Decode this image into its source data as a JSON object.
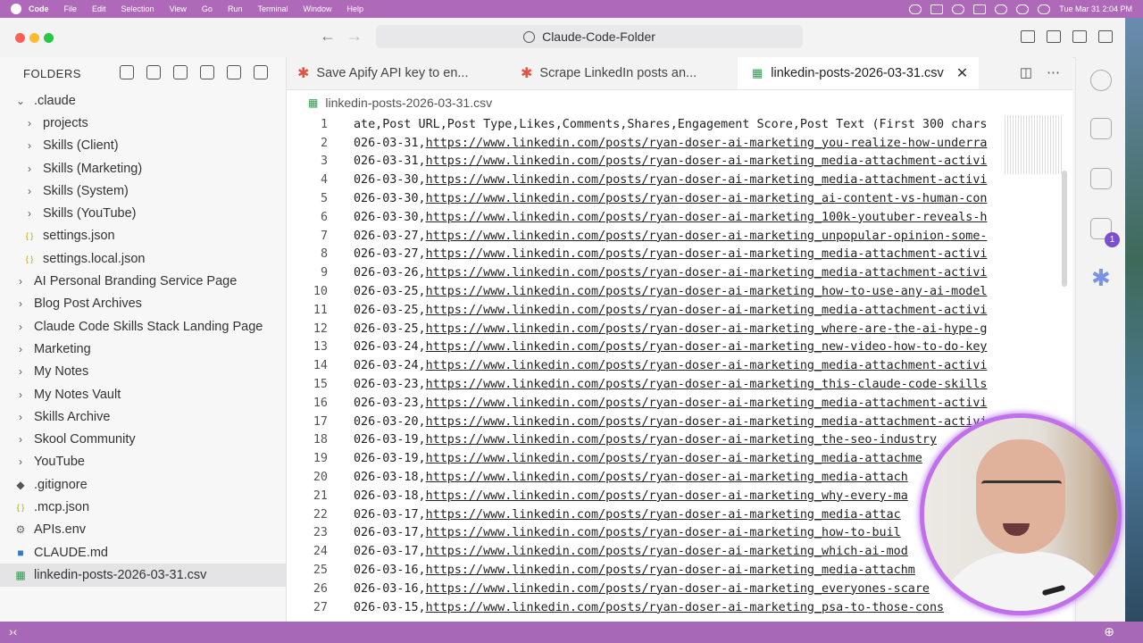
{
  "menubar": {
    "app": "Code",
    "items": [
      "File",
      "Edit",
      "Selection",
      "View",
      "Go",
      "Run",
      "Terminal",
      "Window",
      "Help"
    ],
    "clock": "Tue Mar 31  2:04 PM"
  },
  "titlebar": {
    "command_center": "Claude-Code-Folder"
  },
  "sidebar": {
    "header": "FOLDERS",
    "root": ".claude",
    "items": [
      {
        "label": "projects",
        "type": "folder",
        "indent": 1
      },
      {
        "label": "Skills (Client)",
        "type": "folder",
        "indent": 1
      },
      {
        "label": "Skills (Marketing)",
        "type": "folder",
        "indent": 1
      },
      {
        "label": "Skills (System)",
        "type": "folder",
        "indent": 1
      },
      {
        "label": "Skills (YouTube)",
        "type": "folder",
        "indent": 1
      },
      {
        "label": "settings.json",
        "type": "json",
        "indent": 1
      },
      {
        "label": "settings.local.json",
        "type": "json",
        "indent": 1
      },
      {
        "label": "AI Personal Branding Service Page",
        "type": "folder",
        "indent": 0
      },
      {
        "label": "Blog Post Archives",
        "type": "folder",
        "indent": 0
      },
      {
        "label": "Claude Code Skills Stack Landing Page",
        "type": "folder",
        "indent": 0
      },
      {
        "label": "Marketing",
        "type": "folder",
        "indent": 0
      },
      {
        "label": "My Notes",
        "type": "folder",
        "indent": 0
      },
      {
        "label": "My Notes Vault",
        "type": "folder",
        "indent": 0
      },
      {
        "label": "Skills Archive",
        "type": "folder",
        "indent": 0
      },
      {
        "label": "Skool Community",
        "type": "folder",
        "indent": 0
      },
      {
        "label": "YouTube",
        "type": "folder",
        "indent": 0
      },
      {
        "label": ".gitignore",
        "type": "git",
        "indent": 0
      },
      {
        "label": ".mcp.json",
        "type": "json",
        "indent": 0
      },
      {
        "label": "APIs.env",
        "type": "gear",
        "indent": 0
      },
      {
        "label": "CLAUDE.md",
        "type": "md",
        "indent": 0
      },
      {
        "label": "linkedin-posts-2026-03-31.csv",
        "type": "csv",
        "indent": 0
      }
    ]
  },
  "tabs": [
    {
      "label": "Save Apify API key to en...",
      "active": false
    },
    {
      "label": "Scrape LinkedIn posts an...",
      "active": false
    },
    {
      "label": "linkedin-posts-2026-03-31.csv",
      "active": true
    }
  ],
  "editor": {
    "breadcrumb": "linkedin-posts-2026-03-31.csv",
    "header_line": "ate,Post URL,Post Type,Likes,Comments,Shares,Engagement Score,Post Text (First 300 chars",
    "rows": [
      {
        "date": "026-03-31,",
        "url": "https://www.linkedin.com/posts/ryan-doser-ai-marketing_you-realize-how-underra"
      },
      {
        "date": "026-03-31,",
        "url": "https://www.linkedin.com/posts/ryan-doser-ai-marketing_media-attachment-activi"
      },
      {
        "date": "026-03-30,",
        "url": "https://www.linkedin.com/posts/ryan-doser-ai-marketing_media-attachment-activi"
      },
      {
        "date": "026-03-30,",
        "url": "https://www.linkedin.com/posts/ryan-doser-ai-marketing_ai-content-vs-human-con"
      },
      {
        "date": "026-03-30,",
        "url": "https://www.linkedin.com/posts/ryan-doser-ai-marketing_100k-youtuber-reveals-h"
      },
      {
        "date": "026-03-27,",
        "url": "https://www.linkedin.com/posts/ryan-doser-ai-marketing_unpopular-opinion-some-"
      },
      {
        "date": "026-03-27,",
        "url": "https://www.linkedin.com/posts/ryan-doser-ai-marketing_media-attachment-activi"
      },
      {
        "date": "026-03-26,",
        "url": "https://www.linkedin.com/posts/ryan-doser-ai-marketing_media-attachment-activi"
      },
      {
        "date": "026-03-25,",
        "url": "https://www.linkedin.com/posts/ryan-doser-ai-marketing_how-to-use-any-ai-model"
      },
      {
        "date": "026-03-25,",
        "url": "https://www.linkedin.com/posts/ryan-doser-ai-marketing_media-attachment-activi"
      },
      {
        "date": "026-03-25,",
        "url": "https://www.linkedin.com/posts/ryan-doser-ai-marketing_where-are-the-ai-hype-g"
      },
      {
        "date": "026-03-24,",
        "url": "https://www.linkedin.com/posts/ryan-doser-ai-marketing_new-video-how-to-do-key"
      },
      {
        "date": "026-03-24,",
        "url": "https://www.linkedin.com/posts/ryan-doser-ai-marketing_media-attachment-activi"
      },
      {
        "date": "026-03-23,",
        "url": "https://www.linkedin.com/posts/ryan-doser-ai-marketing_this-claude-code-skills"
      },
      {
        "date": "026-03-23,",
        "url": "https://www.linkedin.com/posts/ryan-doser-ai-marketing_media-attachment-activi"
      },
      {
        "date": "026-03-20,",
        "url": "https://www.linkedin.com/posts/ryan-doser-ai-marketing_media-attachment-activi"
      },
      {
        "date": "026-03-19,",
        "url": "https://www.linkedin.com/posts/ryan-doser-ai-marketing_the-seo-industry"
      },
      {
        "date": "026-03-19,",
        "url": "https://www.linkedin.com/posts/ryan-doser-ai-marketing_media-attachme"
      },
      {
        "date": "026-03-18,",
        "url": "https://www.linkedin.com/posts/ryan-doser-ai-marketing_media-attach"
      },
      {
        "date": "026-03-18,",
        "url": "https://www.linkedin.com/posts/ryan-doser-ai-marketing_why-every-ma"
      },
      {
        "date": "026-03-17,",
        "url": "https://www.linkedin.com/posts/ryan-doser-ai-marketing_media-attac"
      },
      {
        "date": "026-03-17,",
        "url": "https://www.linkedin.com/posts/ryan-doser-ai-marketing_how-to-buil"
      },
      {
        "date": "026-03-17,",
        "url": "https://www.linkedin.com/posts/ryan-doser-ai-marketing_which-ai-mod"
      },
      {
        "date": "026-03-16,",
        "url": "https://www.linkedin.com/posts/ryan-doser-ai-marketing_media-attachm"
      },
      {
        "date": "026-03-16,",
        "url": "https://www.linkedin.com/posts/ryan-doser-ai-marketing_everyones-scare"
      },
      {
        "date": "026-03-15,",
        "url": "https://www.linkedin.com/posts/ryan-doser-ai-marketing_psa-to-those-cons"
      }
    ]
  },
  "activity": {
    "badge": "1"
  },
  "colors": {
    "menubar": "#ae6ab9",
    "statusbar": "#a868b8",
    "webcam_ring": "#c070e8"
  }
}
